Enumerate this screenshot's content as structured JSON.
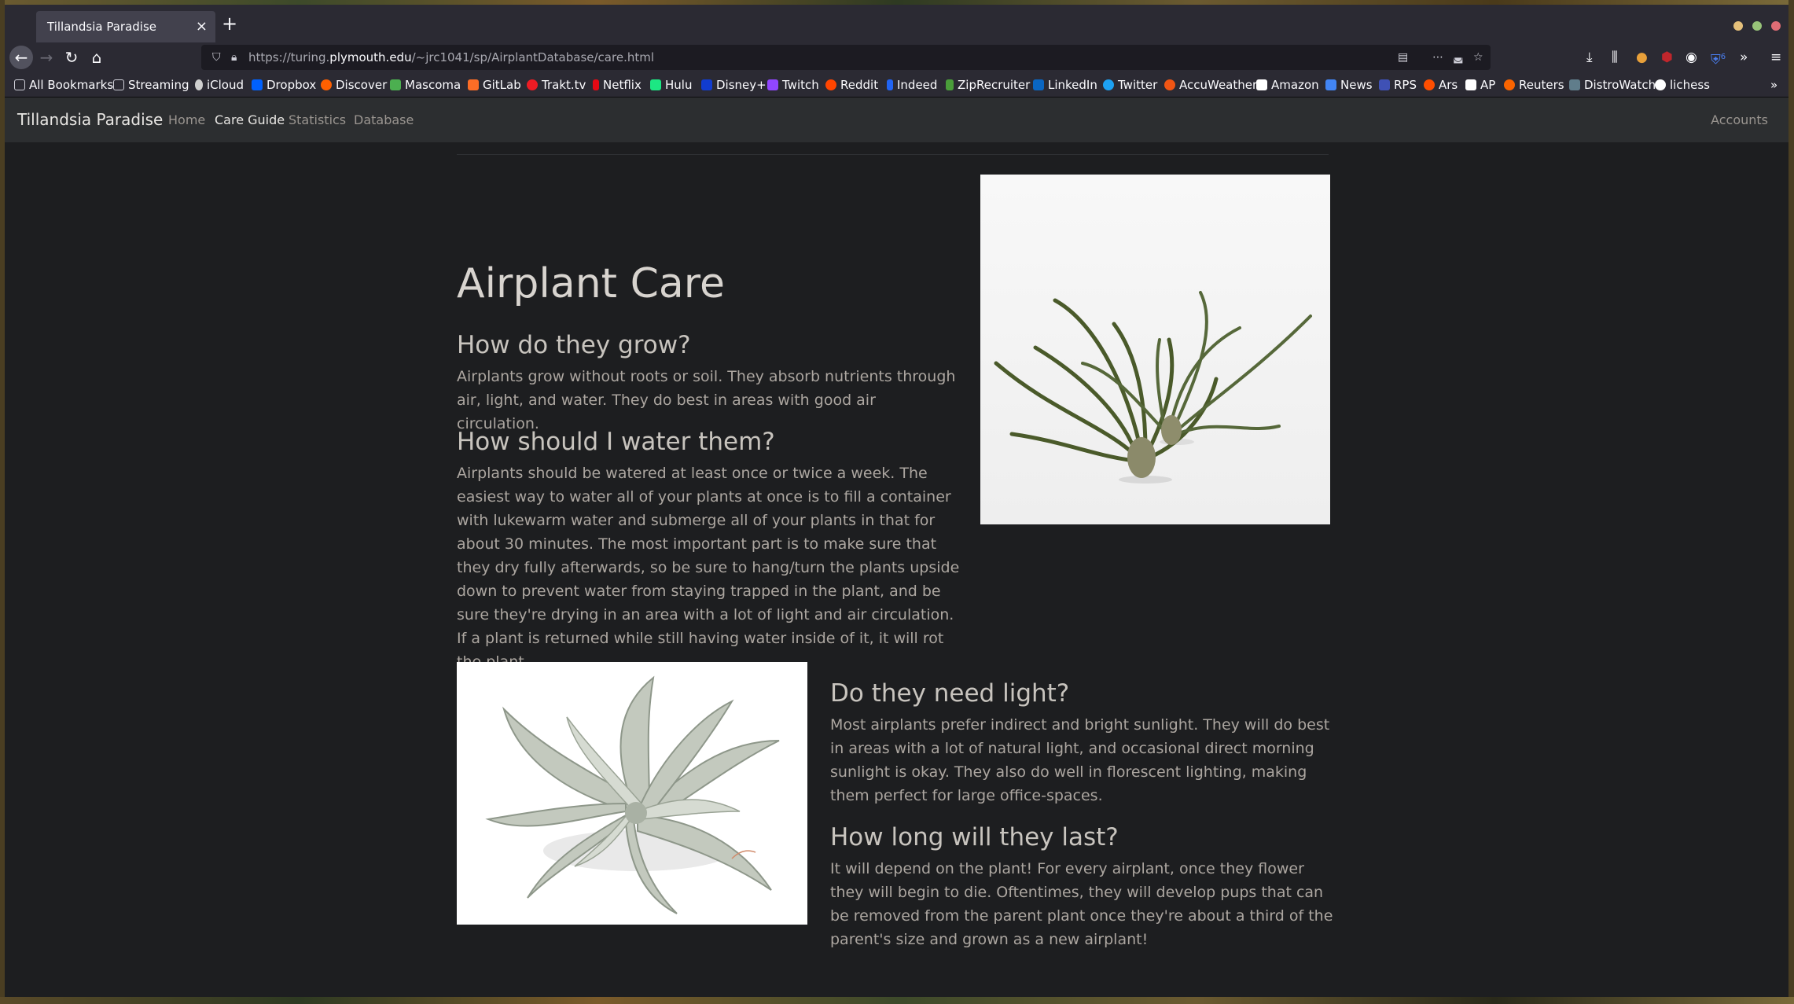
{
  "browser": {
    "tab_title": "Tillandsia Paradise",
    "url_prefix": "https://turing.",
    "url_domain": "plymouth.edu",
    "url_path": "/~jrc1041/sp/AirplantDatabase/care.html",
    "badge_count": "6"
  },
  "bookmarks": [
    {
      "label": "All Bookmarks",
      "color": "#9e9e9e"
    },
    {
      "label": "Streaming",
      "color": "#9e9e9e"
    },
    {
      "label": "iCloud",
      "color": "#cfcfcf"
    },
    {
      "label": "Dropbox",
      "color": "#0061fe"
    },
    {
      "label": "Discover",
      "color": "#ff6000"
    },
    {
      "label": "Mascoma",
      "color": "#4caf50"
    },
    {
      "label": "GitLab",
      "color": "#fc6d26"
    },
    {
      "label": "Trakt.tv",
      "color": "#ed1c24"
    },
    {
      "label": "Netflix",
      "color": "#e50914"
    },
    {
      "label": "Hulu",
      "color": "#1ce783"
    },
    {
      "label": "Disney+",
      "color": "#113ccf"
    },
    {
      "label": "Twitch",
      "color": "#9146ff"
    },
    {
      "label": "Reddit",
      "color": "#ff4500"
    },
    {
      "label": "Indeed",
      "color": "#2164f3"
    },
    {
      "label": "ZipRecruiter",
      "color": "#4a9e3a"
    },
    {
      "label": "LinkedIn",
      "color": "#0a66c2"
    },
    {
      "label": "Twitter",
      "color": "#1da1f2"
    },
    {
      "label": "AccuWeather",
      "color": "#f05514"
    },
    {
      "label": "Amazon",
      "color": "#ffffff"
    },
    {
      "label": "News",
      "color": "#4285f4"
    },
    {
      "label": "RPS",
      "color": "#3f51b5"
    },
    {
      "label": "Ars",
      "color": "#ff4e00"
    },
    {
      "label": "AP",
      "color": "#ffffff"
    },
    {
      "label": "Reuters",
      "color": "#fa6400"
    },
    {
      "label": "DistroWatch",
      "color": "#607d8b"
    },
    {
      "label": "lichess",
      "color": "#ffffff"
    }
  ],
  "site": {
    "brand": "Tillandsia Paradise",
    "nav": [
      "Home",
      "Care Guide",
      "Statistics",
      "Database"
    ],
    "accounts": "Accounts"
  },
  "page": {
    "title": "Airplant Care",
    "sections": [
      {
        "heading": "How do they grow?",
        "body": "Airplants grow without roots or soil. They absorb nutrients through air, light, and water. They do best in areas with good air circulation."
      },
      {
        "heading": "How should I water them?",
        "body": "Airplants should be watered at least once or twice a week. The easiest way to water all of your plants at once is to fill a container with lukewarm water and submerge all of your plants in that for about 30 minutes. The most important part is to make sure that they dry fully afterwards, so be sure to hang/turn the plants upside down to prevent water from staying trapped in the plant, and be sure they're drying in an area with a lot of light and air circulation. If a plant is returned while still having water inside of it, it will rot the plant."
      },
      {
        "heading": "Do they need light?",
        "body": "Most airplants prefer indirect and bright sunlight. They will do best in areas with a lot of natural light, and occasional direct morning sunlight is okay. They also do well in florescent lighting, making them perfect for large office-spaces."
      },
      {
        "heading": "How long will they last?",
        "body": "It will depend on the plant! For every airplant, once they flower they will begin to die. Oftentimes, they will develop pups that can be removed from the parent plant once they're about a third of the parent's size and grown as a new airplant!"
      }
    ]
  }
}
